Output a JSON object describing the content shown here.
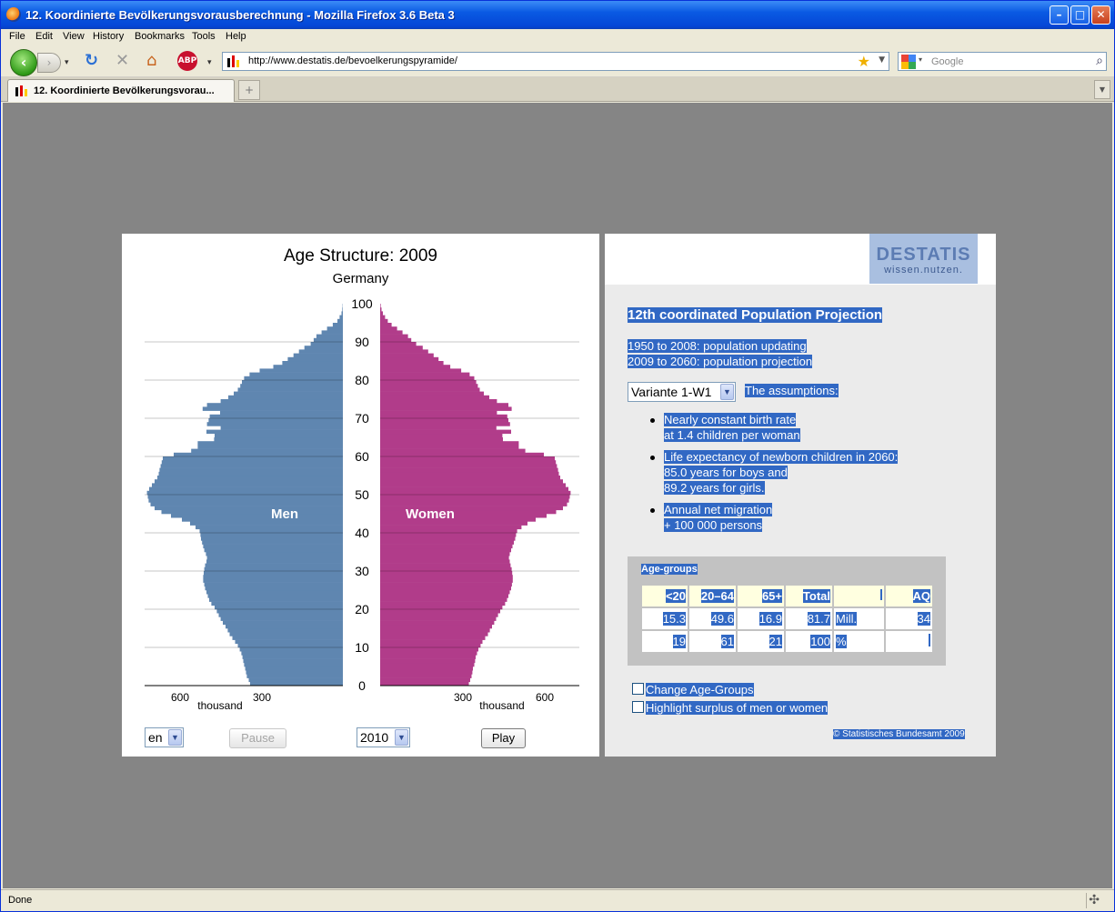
{
  "window": {
    "title": "12. Koordinierte Bevölkerungsvorausberechnung - Mozilla Firefox 3.6 Beta 3"
  },
  "menu": [
    "File",
    "Edit",
    "View",
    "History",
    "Bookmarks",
    "Tools",
    "Help"
  ],
  "nav": {
    "url": "http://www.destatis.de/bevoelkerungspyramide/",
    "search_placeholder": "Google"
  },
  "tab": {
    "title": "12. Koordinierte Bevölkerungsvorau..."
  },
  "status": {
    "text": "Done"
  },
  "chart_panel": {
    "title": "Age Structure: 2009",
    "subtitle": "Germany",
    "men_label": "Men",
    "women_label": "Women",
    "x_unit": "thousand",
    "language": "en",
    "pause_label": "Pause",
    "year_select": "2010",
    "play_label": "Play"
  },
  "chart_data": {
    "type": "bar",
    "orientation": "horizontal-pyramid",
    "y_ticks": [
      0,
      10,
      20,
      30,
      40,
      50,
      60,
      70,
      80,
      90,
      100
    ],
    "x_ticks_left": [
      "600",
      "300"
    ],
    "x_ticks_right": [
      "300",
      "600"
    ],
    "xlim": [
      0,
      700
    ],
    "ylim": [
      0,
      100
    ],
    "colors": {
      "men": "#5f86b0",
      "women": "#b13c8a"
    },
    "series": [
      {
        "name": "Men",
        "values": [
          340,
          345,
          352,
          355,
          358,
          362,
          365,
          368,
          372,
          378,
          385,
          395,
          405,
          415,
          422,
          430,
          440,
          448,
          455,
          462,
          470,
          482,
          490,
          495,
          500,
          505,
          508,
          512,
          512,
          510,
          508,
          505,
          500,
          498,
          502,
          508,
          512,
          516,
          520,
          522,
          525,
          540,
          560,
          590,
          630,
          665,
          690,
          705,
          712,
          715,
          718,
          710,
          700,
          690,
          680,
          675,
          672,
          668,
          664,
          660,
          620,
          556,
          532,
          532,
          472,
          470,
          500,
          448,
          498,
          492,
          488,
          450,
          514,
          498,
          448,
          420,
          400,
          385,
          376,
          370,
          362,
          342,
          305,
          255,
          222,
          202,
          181,
          161,
          141,
          118,
          107,
          97,
          78,
          58,
          37,
          20,
          12,
          5,
          2,
          1,
          0
        ]
      },
      {
        "name": "Women",
        "values": [
          325,
          330,
          335,
          338,
          340,
          345,
          348,
          350,
          355,
          360,
          368,
          375,
          385,
          395,
          402,
          410,
          418,
          425,
          432,
          440,
          448,
          458,
          465,
          470,
          475,
          480,
          483,
          486,
          486,
          484,
          482,
          478,
          475,
          472,
          475,
          480,
          485,
          490,
          495,
          498,
          502,
          518,
          540,
          570,
          610,
          645,
          670,
          685,
          692,
          695,
          698,
          690,
          680,
          670,
          660,
          655,
          652,
          648,
          644,
          640,
          600,
          532,
          508,
          508,
          450,
          448,
          480,
          426,
          476,
          470,
          466,
          428,
          482,
          470,
          428,
          400,
          380,
          365,
          358,
          352,
          345,
          328,
          297,
          257,
          232,
          214,
          196,
          176,
          156,
          132,
          114,
          102,
          82,
          62,
          42,
          28,
          18,
          10,
          5,
          2,
          0
        ]
      }
    ]
  },
  "logo": {
    "brand": "DESTATIS",
    "tagline": "wissen.nutzen."
  },
  "info": {
    "heading": "12th coordinated Population Projection",
    "line1": "1950 to 2008: population updating",
    "line2": "2009 to 2060: population projection",
    "variant": "Variante 1-W1",
    "assumptions_label": "The assumptions:",
    "bullets": [
      {
        "l1": "Nearly constant birth rate",
        "l2": "at 1.4 children per woman",
        "l3": ""
      },
      {
        "l1": "Life expectancy of newborn children in 2060:",
        "l2": "85.0 years for boys and",
        "l3": "89.2 years for girls."
      },
      {
        "l1": "Annual net migration",
        "l2": "+ 100 000 persons",
        "l3": ""
      }
    ],
    "age_groups": {
      "label": "Age-groups",
      "headers": [
        "<20",
        "20–64",
        "65+",
        "Total",
        "",
        "AQ"
      ],
      "row1": [
        "15.3",
        "49.6",
        "16.9",
        "81.7",
        "Mill.",
        "34"
      ],
      "row2": [
        "19",
        "61",
        "21",
        "100",
        "%",
        ""
      ]
    },
    "checkbox1": "Change Age-Groups",
    "checkbox2": "Highlight surplus of men or women",
    "copyright": "© Statistisches Bundesamt 2009"
  }
}
